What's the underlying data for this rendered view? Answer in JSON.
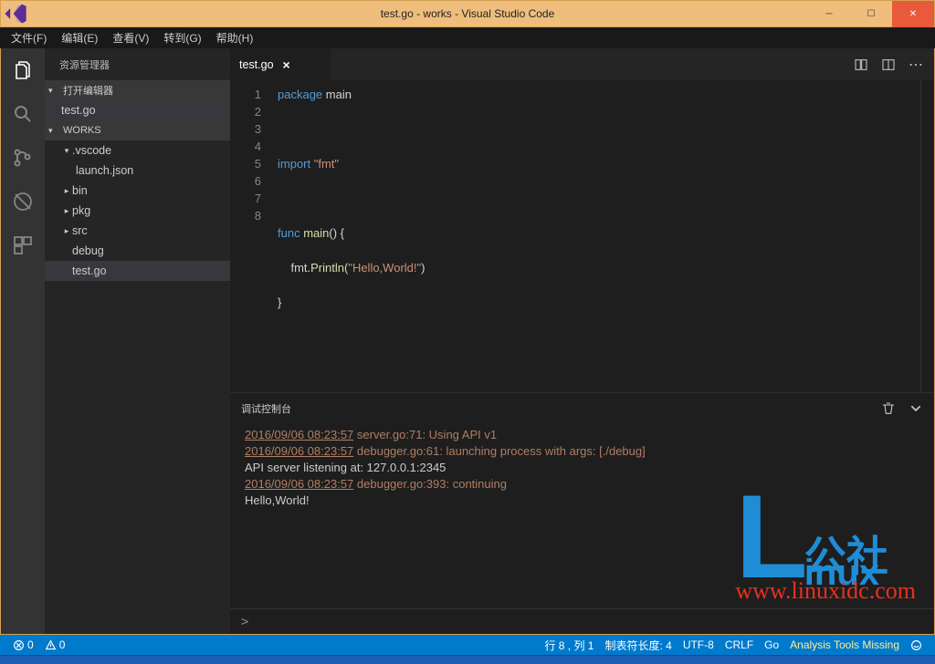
{
  "window": {
    "title": "test.go - works - Visual Studio Code"
  },
  "menu": {
    "file": "文件(F)",
    "edit": "编辑(E)",
    "view": "查看(V)",
    "goto": "转到(G)",
    "help": "帮助(H)"
  },
  "sidebar": {
    "title": "资源管理器",
    "openEditors": "打开编辑器",
    "workspace": "WORKS",
    "openFile": "test.go",
    "tree": {
      "vscode": ".vscode",
      "launch": "launch.json",
      "bin": "bin",
      "pkg": "pkg",
      "src": "src",
      "debug": "debug",
      "testgo": "test.go"
    }
  },
  "tab": {
    "name": "test.go"
  },
  "code": {
    "l1_kw": "package",
    "l1_id": " main",
    "l3_kw": "import",
    "l3_str": " \"fmt\"",
    "l5_kw": "func",
    "l5_fn": " main",
    "l5_rest": "() {",
    "l6_ind": "    ",
    "l6_obj": "fmt.",
    "l6_fn": "Println",
    "l6_p1": "(",
    "l6_str": "\"Hello,World!\"",
    "l6_p2": ")",
    "l7": "}"
  },
  "gutter": [
    "1",
    "2",
    "3",
    "4",
    "5",
    "6",
    "7",
    "8"
  ],
  "panel": {
    "title": "调试控制台",
    "lines": [
      {
        "ts": "2016/09/06 08:23:57",
        "msg": " server.go:71: Using API v1"
      },
      {
        "ts": "2016/09/06 08:23:57",
        "msg": " debugger.go:61: launching process with args: [./debug]"
      },
      {
        "plain": "API server listening at: 127.0.0.1:2345"
      },
      {
        "ts": "2016/09/06 08:23:57",
        "msg": " debugger.go:393: continuing"
      },
      {
        "plain": "Hello,World!"
      }
    ],
    "prompt": ">"
  },
  "watermark": {
    "cn": "公社",
    "inux": "inux",
    "url": "www.linuxidc.com"
  },
  "status": {
    "errors": "0",
    "warnings": "0",
    "pos": "行 8 , 列 1",
    "tabsize": "制表符长度: 4",
    "encoding": "UTF-8",
    "eol": "CRLF",
    "lang": "Go",
    "missing": "Analysis Tools Missing"
  }
}
